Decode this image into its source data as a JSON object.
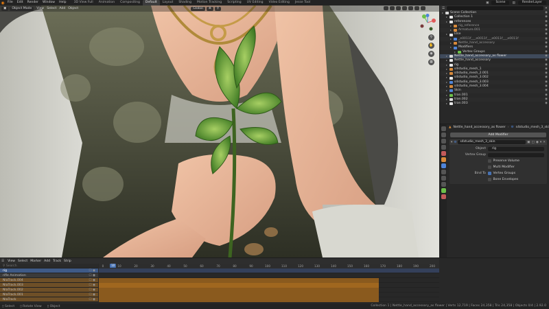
{
  "topbar": {
    "menus": [
      "File",
      "Edit",
      "Render",
      "Window",
      "Help"
    ],
    "workspaces": [
      "3D View Full",
      "Animation",
      "Compositing",
      "Default",
      "Layout",
      "Shading",
      "Motion Tracking",
      "Scripting",
      "UV Editing",
      "Video Editing",
      "Jesse Tool"
    ],
    "active_workspace": "Default",
    "scene": "Scene",
    "view_layer": "RenderLayer"
  },
  "viewport": {
    "mode": "Object Mode",
    "menus": [
      "View",
      "Select",
      "Add",
      "Object"
    ],
    "orientation": "Global"
  },
  "outliner": {
    "title": "Scene Collection",
    "rows": [
      {
        "label": "Scene Collection",
        "indent": 0,
        "color": "#cfcfcf",
        "selected": false
      },
      {
        "label": "Collection 1",
        "indent": 1,
        "color": "#cfcfcf",
        "selected": false
      },
      {
        "label": "references",
        "indent": 1,
        "color": "#cfcfcf",
        "selected": false
      },
      {
        "label": "rig_reference",
        "indent": 2,
        "color": "#9a9a9a",
        "selected": false
      },
      {
        "label": "Armature.001",
        "indent": 2,
        "color": "#9a9a9a",
        "selected": false
      },
      {
        "label": "Else",
        "indent": 1,
        "color": "#cfcfcf",
        "selected": false
      },
      {
        "label": "_e0011f___e0011f___e0011f___e0011f",
        "indent": 2,
        "color": "#9a9a9a",
        "selected": false
      },
      {
        "label": "Nettle_hand_accessory",
        "indent": 2,
        "color": "#9a9a9a",
        "selected": false
      },
      {
        "label": "Modifiers",
        "indent": 2,
        "color": "#cfcfcf",
        "selected": false
      },
      {
        "label": "Vertex Groups",
        "indent": 3,
        "color": "#cfcfcf",
        "selected": false
      },
      {
        "label": "Nettle_hand_accessory_as flower",
        "indent": 1,
        "color": "#e0e0e0",
        "selected": true
      },
      {
        "label": "Nettle_hand_accessory",
        "indent": 1,
        "color": "#cfcfcf",
        "selected": false
      },
      {
        "label": "rig",
        "indent": 1,
        "color": "#cfcfcf",
        "selected": false
      },
      {
        "label": "s4studio_mesh_1",
        "indent": 1,
        "color": "#cfcfcf",
        "selected": false
      },
      {
        "label": "s4studio_mesh_2.001",
        "indent": 1,
        "color": "#cfcfcf",
        "selected": false
      },
      {
        "label": "s4studio_mesh_3.002",
        "indent": 1,
        "color": "#cfcfcf",
        "selected": false
      },
      {
        "label": "s4studio_mesh_3.003",
        "indent": 1,
        "color": "#cfcfcf",
        "selected": false
      },
      {
        "label": "s4studio_mesh_3.004",
        "indent": 1,
        "color": "#cfcfcf",
        "selected": false
      },
      {
        "label": "Skin",
        "indent": 1,
        "color": "#cfcfcf",
        "selected": false
      },
      {
        "label": "tran.001",
        "indent": 1,
        "color": "#cfcfcf",
        "selected": false
      },
      {
        "label": "tran.002",
        "indent": 1,
        "color": "#cfcfcf",
        "selected": false
      },
      {
        "label": "tran.003",
        "indent": 1,
        "color": "#cfcfcf",
        "selected": false
      }
    ]
  },
  "properties": {
    "breadcrumb_object": "Nettle_hand_accessory_as flower",
    "breadcrumb_modifier": "s4studio_mesh_3_skin",
    "add_modifier_label": "Add Modifier",
    "modifier_name": "s4studio_mesh_3_skin",
    "object_label": "Object",
    "object_value": "rig",
    "vertex_group_label": "Vertex Group",
    "preserve_volume_label": "Preserve Volume",
    "multi_modifier_label": "Multi Modifier",
    "bind_to_label": "Bind To",
    "vertex_groups_label": "Vertex Groups",
    "bone_envelopes_label": "Bone Envelopes"
  },
  "timeline": {
    "menus": [
      "View",
      "Select",
      "Marker",
      "Add",
      "Track",
      "Strip"
    ],
    "search_placeholder": "Search",
    "channels": [
      {
        "label": "rig",
        "selected": true
      },
      {
        "label": "rifle Animation",
        "selected": false
      },
      {
        "label": "NlaTrack.004",
        "selected": false
      },
      {
        "label": "NlaTrack.003",
        "selected": false
      },
      {
        "label": "NlaTrack.002",
        "selected": false
      },
      {
        "label": "NlaTrack.001",
        "selected": false
      },
      {
        "label": "NlaTrack",
        "selected": false
      }
    ],
    "current_frame": "10",
    "ticks": [
      "0",
      "10",
      "20",
      "30",
      "40",
      "50",
      "60",
      "70",
      "80",
      "90",
      "100",
      "110",
      "120",
      "130",
      "140",
      "150",
      "160",
      "170",
      "180",
      "190",
      "200"
    ]
  },
  "statusbar": {
    "items": [
      "Select",
      "Rotate View",
      "Object"
    ],
    "right_text": "Collection 1 | Nettle_hand_accessory_as flower | Verts 12,719 | Faces 24,358 | Tris 24,358 | Objects 0/4 | 2.92.0"
  }
}
